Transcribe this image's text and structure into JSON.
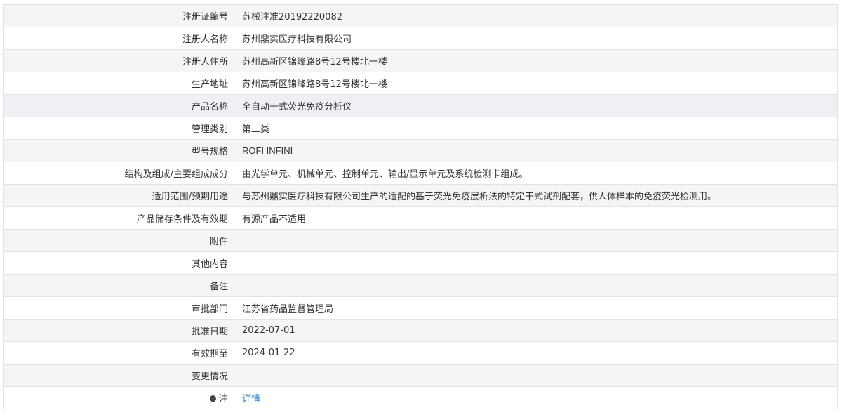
{
  "rows": [
    {
      "label": "注册证编号",
      "value": "苏械注准20192220082"
    },
    {
      "label": "注册人名称",
      "value": "苏州鼎实医疗科技有限公司"
    },
    {
      "label": "注册人住所",
      "value": "苏州高新区锦峰路8号12号楼北一楼"
    },
    {
      "label": "生产地址",
      "value": "苏州高新区锦峰路8号12号楼北一楼"
    },
    {
      "label": "产品名称",
      "value": "全自动干式荧光免疫分析仪"
    },
    {
      "label": "管理类别",
      "value": "第二类"
    },
    {
      "label": "型号规格",
      "value": "ROFI INFINI"
    },
    {
      "label": "结构及组成/主要组成成分",
      "value": "由光学单元、机械单元、控制单元、输出/显示单元及系统检测卡组成。"
    },
    {
      "label": "适用范围/预期用途",
      "value": "与苏州鼎实医疗科技有限公司生产的适配的基于荧光免疫层析法的特定干式试剂配套，供人体样本的免疫荧光检测用。"
    },
    {
      "label": "产品储存条件及有效期",
      "value": "有源产品不适用"
    },
    {
      "label": "附件",
      "value": ""
    },
    {
      "label": "其他内容",
      "value": ""
    },
    {
      "label": "备注",
      "value": ""
    },
    {
      "label": "审批部门",
      "value": "江苏省药品监督管理局"
    },
    {
      "label": "批准日期",
      "value": "2022-07-01"
    },
    {
      "label": "有效期至",
      "value": "2024-01-22"
    },
    {
      "label": "变更情况",
      "value": ""
    }
  ],
  "note": {
    "icon": "location-pin-icon",
    "label": "注",
    "link_text": "详情",
    "link_color": "#2f7fd0"
  }
}
